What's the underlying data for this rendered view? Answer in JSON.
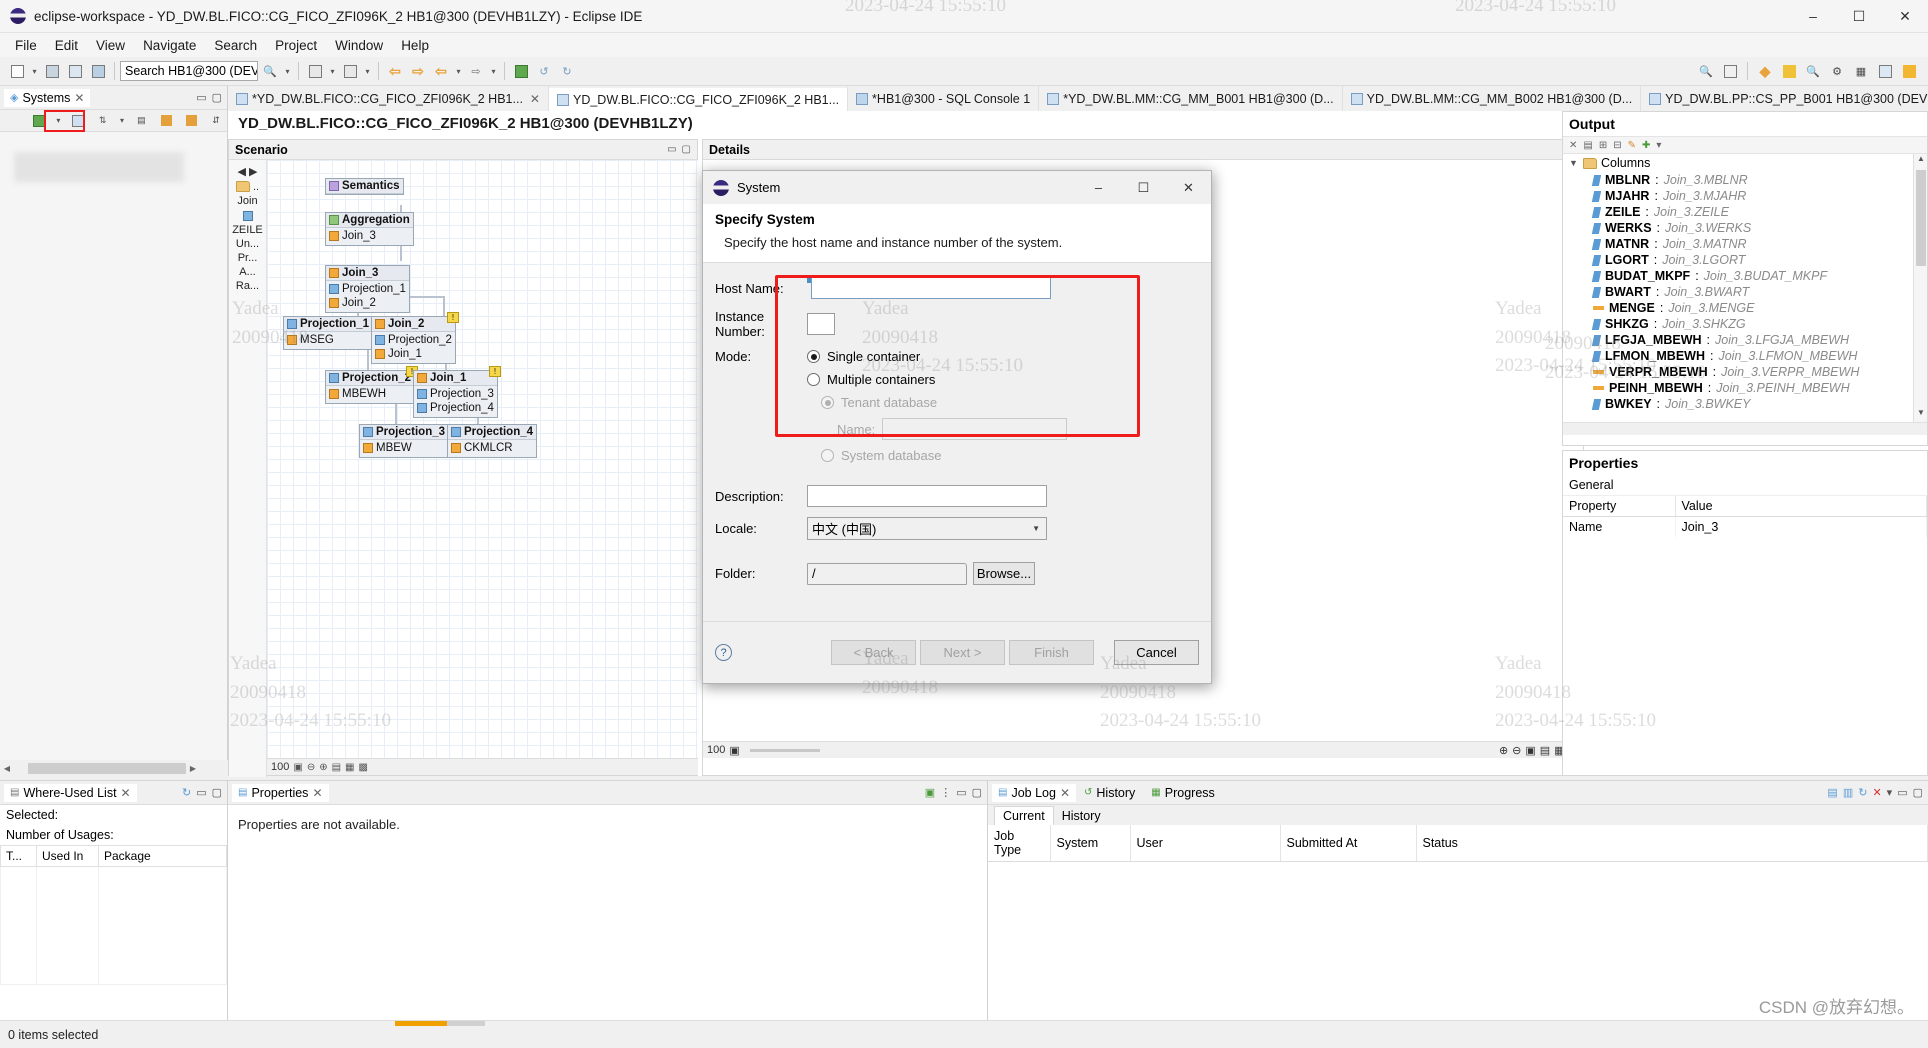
{
  "window": {
    "title": "eclipse-workspace - YD_DW.BL.FICO::CG_FICO_ZFI096K_2 HB1@300 (DEVHB1LZY)  - Eclipse IDE",
    "minimize": "–",
    "maximize": "☐",
    "close": "✕"
  },
  "menu": {
    "items": [
      "File",
      "Edit",
      "View",
      "Navigate",
      "Search",
      "Project",
      "Window",
      "Help"
    ]
  },
  "toolbar": {
    "search_value": "Search HB1@300 (DEV"
  },
  "editor_tabs": [
    {
      "label": "*YD_DW.BL.FICO::CG_FICO_ZFI096K_2 HB1...",
      "closable": true,
      "active": false
    },
    {
      "label": "YD_DW.BL.FICO::CG_FICO_ZFI096K_2 HB1...",
      "closable": false,
      "active": true
    },
    {
      "label": "*HB1@300 - SQL Console 1",
      "closable": false,
      "active": false
    },
    {
      "label": "*YD_DW.BL.MM::CG_MM_B001 HB1@300 (D...",
      "closable": false,
      "active": false
    },
    {
      "label": "YD_DW.BL.MM::CG_MM_B002 HB1@300 (D...",
      "closable": false,
      "active": false
    },
    {
      "label": "YD_DW.BL.PP::CS_PP_B001 HB1@300 (DEV",
      "closable": false,
      "active": false
    }
  ],
  "systems_view": {
    "tab_label": "Systems",
    "close": "✕"
  },
  "editor": {
    "title": "YD_DW.BL.FICO::CG_FICO_ZFI096K_2 HB1@300 (DEVHB1LZY)",
    "scenario_header": "Scenario",
    "details_header": "Details",
    "scenario_zoom": "100",
    "details_zoom": "100",
    "tool_labels": [
      "Join",
      "ZEILE",
      "Un...",
      "Pr...",
      "A...",
      "Ra..."
    ],
    "detail_node_title": "Join_3",
    "nodes": [
      {
        "title": "Semantics",
        "rows": []
      },
      {
        "title": "Aggregation",
        "rows": [
          "Join_3"
        ]
      },
      {
        "title": "Join_3",
        "rows": [
          "Projection_1",
          "Join_2"
        ]
      },
      {
        "title": "Projection_1",
        "rows": [
          "MSEG"
        ]
      },
      {
        "title": "Join_2",
        "rows": [
          "Projection_2",
          "Join_1"
        ]
      },
      {
        "title": "Projection_2",
        "rows": [
          "MBEWH"
        ]
      },
      {
        "title": "Join_1",
        "rows": [
          "Projection_3",
          "Projection_4"
        ]
      },
      {
        "title": "Projection_3",
        "rows": [
          "MBEW"
        ]
      },
      {
        "title": "Projection_4",
        "rows": [
          "CKMLCR"
        ]
      }
    ]
  },
  "output": {
    "title": "Output",
    "root_label": "Columns",
    "columns": [
      {
        "name": "MBLNR",
        "value": "Join_3.MBLNR",
        "kind": "str"
      },
      {
        "name": "MJAHR",
        "value": "Join_3.MJAHR",
        "kind": "str"
      },
      {
        "name": "ZEILE",
        "value": "Join_3.ZEILE",
        "kind": "str"
      },
      {
        "name": "WERKS",
        "value": "Join_3.WERKS",
        "kind": "str"
      },
      {
        "name": "MATNR",
        "value": "Join_3.MATNR",
        "kind": "str"
      },
      {
        "name": "LGORT",
        "value": "Join_3.LGORT",
        "kind": "str"
      },
      {
        "name": "BUDAT_MKPF",
        "value": "Join_3.BUDAT_MKPF",
        "kind": "str"
      },
      {
        "name": "BWART",
        "value": "Join_3.BWART",
        "kind": "str"
      },
      {
        "name": "MENGE",
        "value": "Join_3.MENGE",
        "kind": "num"
      },
      {
        "name": "SHKZG",
        "value": "Join_3.SHKZG",
        "kind": "str"
      },
      {
        "name": "LFGJA_MBEWH",
        "value": "Join_3.LFGJA_MBEWH",
        "kind": "str"
      },
      {
        "name": "LFMON_MBEWH",
        "value": "Join_3.LFMON_MBEWH",
        "kind": "str"
      },
      {
        "name": "VERPR_MBEWH",
        "value": "Join_3.VERPR_MBEWH",
        "kind": "num"
      },
      {
        "name": "PEINH_MBEWH",
        "value": "Join_3.PEINH_MBEWH",
        "kind": "num"
      },
      {
        "name": "BWKEY",
        "value": "Join_3.BWKEY",
        "kind": "str"
      }
    ]
  },
  "properties_panel": {
    "title": "Properties",
    "general": "General",
    "col_property": "Property",
    "col_value": "Value",
    "row_name_label": "Name",
    "row_name_value": "Join_3"
  },
  "where_used": {
    "tab_label": "Where-Used List",
    "close": "✕",
    "selected_label": "Selected:",
    "usages_label": "Number of Usages:",
    "columns": [
      "T...",
      "Used In",
      "Package"
    ]
  },
  "properties_view": {
    "tab_label": "Properties",
    "close": "✕",
    "message": "Properties are not available."
  },
  "job_log": {
    "tabs": [
      "Job Log",
      "History",
      "Progress"
    ],
    "close": "✕",
    "subtabs": [
      "Current",
      "History"
    ],
    "columns": [
      "Job Type",
      "System",
      "User",
      "Submitted At",
      "Status"
    ]
  },
  "status_bar": {
    "text": "0 items selected"
  },
  "dialog": {
    "window_title": "System",
    "minimize": "–",
    "maximize": "☐",
    "close": "✕",
    "heading": "Specify System",
    "subheading": "Specify the host name and instance number of the system.",
    "host_name_label": "Host Name:",
    "host_name_value": "",
    "instance_label": "Instance Number:",
    "instance_value": "",
    "mode_label": "Mode:",
    "mode_single": "Single container",
    "mode_multiple": "Multiple containers",
    "mode_tenant": "Tenant database",
    "tenant_name_label": "Name:",
    "tenant_name_value": "",
    "mode_system_db": "System database",
    "description_label": "Description:",
    "description_value": "",
    "locale_label": "Locale:",
    "locale_value": "中文 (中国)",
    "folder_label": "Folder:",
    "folder_value": "/",
    "browse_label": "Browse...",
    "help_glyph": "?",
    "back_label": "< Back",
    "next_label": "Next >",
    "finish_label": "Finish",
    "cancel_label": "Cancel"
  },
  "watermark": {
    "brand": "Yadea",
    "number": "20090418",
    "datetime": "2023-04-24  15:55:10",
    "csdn": "CSDN @放弃幻想。"
  },
  "colors": {
    "accent_red": "#ef1c1c",
    "node_orange": "#f3a83a",
    "detail_border": "#f0a500",
    "selection_blue": "#7a9cc0"
  }
}
